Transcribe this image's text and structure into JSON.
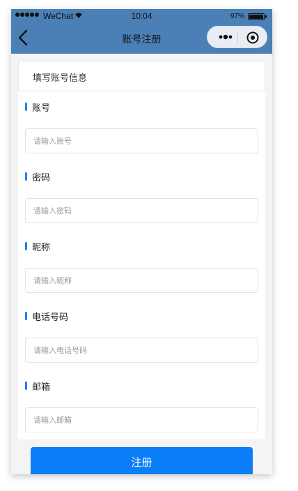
{
  "status_bar": {
    "carrier": "WeChat",
    "time": "10:04",
    "battery": "97%"
  },
  "nav": {
    "title": "账号注册",
    "back_icon": "chevron-left-icon",
    "more_icon": "more-dots-icon",
    "close_icon": "target-circle-icon"
  },
  "form": {
    "header": "填写账号信息",
    "fields": [
      {
        "label": "账号",
        "placeholder": "请输入账号"
      },
      {
        "label": "密码",
        "placeholder": "请输入密码"
      },
      {
        "label": "昵称",
        "placeholder": "请输入昵称"
      },
      {
        "label": "电话号码",
        "placeholder": "请输入电话号码"
      },
      {
        "label": "邮箱",
        "placeholder": "请输入邮箱"
      }
    ],
    "submit_label": "注册"
  },
  "colors": {
    "nav_bg": "#4a80b6",
    "accent": "#1f7ef5",
    "button_bg": "#0b7ef7"
  }
}
